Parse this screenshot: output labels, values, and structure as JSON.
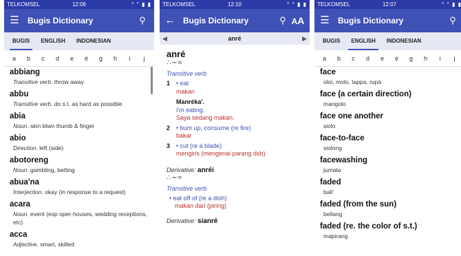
{
  "status": {
    "carrier": "TELKOMSEL",
    "time1": "12:06",
    "time2": "12:10",
    "time3": "12:07",
    "icons": "° ° ▮ ▮"
  },
  "app": {
    "title": "Bugis Dictionary"
  },
  "tabs": {
    "bugis": "BUGIS",
    "english": "ENGLISH",
    "indonesian": "INDONESIAN"
  },
  "alphabet": [
    "a",
    "b",
    "c",
    "d",
    "e",
    "é",
    "g",
    "h",
    "i",
    "j"
  ],
  "screen1": {
    "entries": [
      {
        "word": "abbiang",
        "pos": "Transitive verb",
        "def": ". throw away"
      },
      {
        "word": "abbu",
        "pos": "Transitive verb",
        "def": ". do s.t. as hard as possible"
      },
      {
        "word": "abia",
        "pos": "Noun",
        "def": ". skin btwn thumb & finger"
      },
      {
        "word": "abio",
        "pos": "Direction",
        "def": ". left (side)"
      },
      {
        "word": "abotoreng",
        "pos": "Noun",
        "def": ". gambling, betting"
      },
      {
        "word": "abua'na",
        "pos": "Interjection",
        "def": ". okay (in response to a request)"
      },
      {
        "word": "acara",
        "pos": "Noun",
        "def": ". event (esp oper-houses, wedding receptions, etc)"
      },
      {
        "word": "acca",
        "pos": "Adjective",
        "def": ". smart, skilled"
      }
    ]
  },
  "screen2": {
    "nav_word": "anré",
    "headword": "anré",
    "script": "∴∼≈",
    "pos": "Transitive verb",
    "senses": [
      {
        "num": "1",
        "en": "eat",
        "id": "makan"
      },
      {
        "num": "2",
        "en": "bum up, consume (re fire)",
        "id": "bakar"
      },
      {
        "num": "3",
        "en": "cut (re a blade)",
        "id": "mengiris (mengenai parang dsb)"
      }
    ],
    "example": {
      "bugis": "Manréka'.",
      "en": "I'm eating.",
      "id": "Saya sedang makan."
    },
    "derivative_label": "Derivative:",
    "derivative1": "anréi",
    "derivative1_script": "∴∼≈",
    "derivative1_pos": "Transitive verb",
    "derivative1_sense_en": "eat off of (re a dish)",
    "derivative1_sense_id": "makan dari (piring)",
    "derivative2": "sianré"
  },
  "screen3": {
    "entries": [
      {
        "word": "face",
        "def": "oloi, molo, tappa, rupà"
      },
      {
        "word": "face (a certain direction)",
        "def": "mangolo"
      },
      {
        "word": "face one another",
        "def": "siolo"
      },
      {
        "word": "face-to-face",
        "def": "siolong"
      },
      {
        "word": "facewashing",
        "def": "jumata"
      },
      {
        "word": "faded",
        "def": "bali'"
      },
      {
        "word": "faded (from the sun)",
        "def": "bellang"
      },
      {
        "word": "faded (re. the color of s.t.)",
        "def": "mapirang"
      }
    ]
  }
}
